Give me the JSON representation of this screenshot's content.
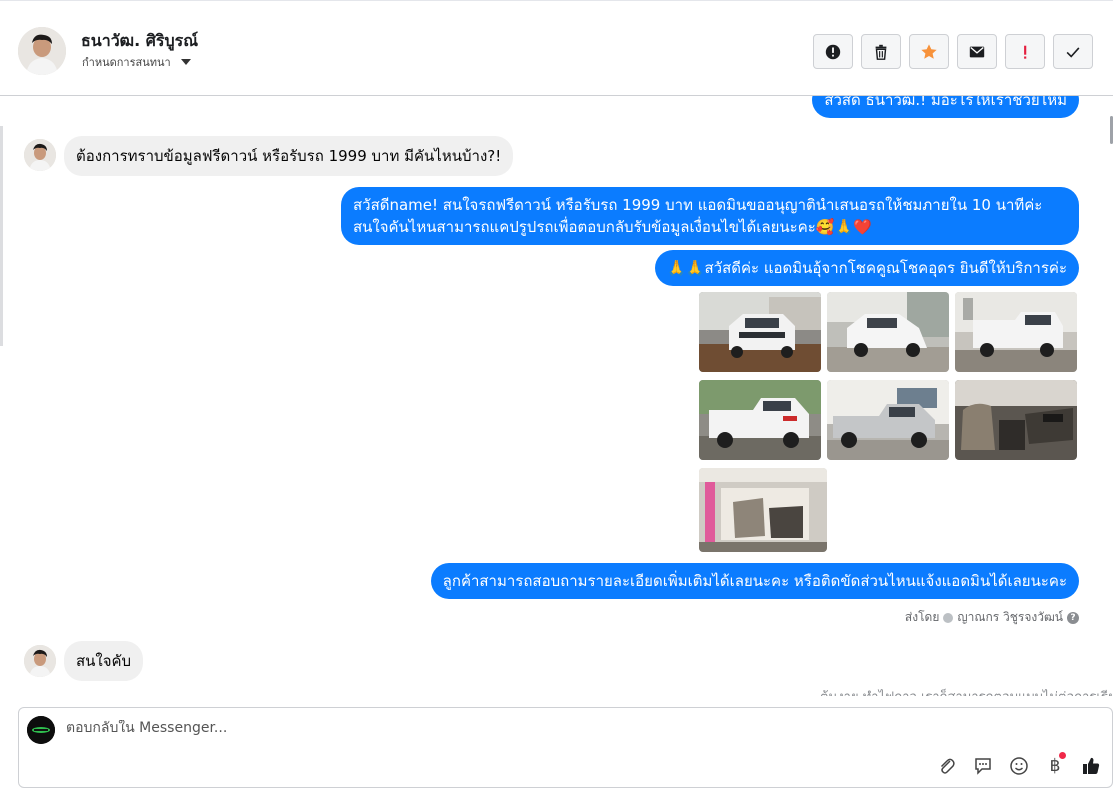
{
  "header": {
    "name": "ธนาวัฒ. ศิริบูรณ์",
    "subtitle": "กำหนดการสนทนา",
    "actions": [
      {
        "icon": "alert-circle-icon"
      },
      {
        "icon": "trash-icon"
      },
      {
        "icon": "star-icon",
        "color": "#f7923b"
      },
      {
        "icon": "mail-icon"
      },
      {
        "icon": "exclamation-icon",
        "color": "#e41e3f"
      },
      {
        "icon": "check-icon"
      }
    ]
  },
  "messages": {
    "top_partial": "สวัสดี ธนาวัฒ.! มีอะไรให้เราช่วยไหม",
    "customer_1": "ต้องการทราบข้อมูลฟรีดาวน์ หรือรับรถ 1999 บาท มีคันไหนบ้าง?!",
    "agent_1": "สวัสดีname! สนใจรถฟรีดาวน์ หรือรับรถ 1999 บาท แอดมินขออนุญาตินำเสนอรถให้ชมภายใน 10 นาทีค่ะ สนใจคันไหนสามารถแคปรูปรถเพื่อตอบกลับรับข้อมูลเงื่อนไขได้เลยนะคะ🥰🙏❤️",
    "agent_2": "🙏🙏สวัสดีค่ะ แอดมินอุ้จากโชคคูณโชคอุดร ยินดีให้บริการค่ะ",
    "agent_3": "ลูกค้าสามารถสอบถามรายละเอียดเพิ่มเติมได้เลยนะคะ หรือติดขัดส่วนไหนแจ้งแอดมินได้เลยนะคะ",
    "sent_by_prefix": "ส่งโดย",
    "sent_by_name": "ญาณกร วิชูรจงวัฒน์",
    "customer_2": "สนใจคับ",
    "bottom_partial": "ต้นงาย ทำไฟกาว เราก็สามารถตอบแบบไม่ต่อการเรียงกัน"
  },
  "photos": [
    {
      "name": "car-photo-1",
      "theme": "front"
    },
    {
      "name": "car-photo-2",
      "theme": "front-side"
    },
    {
      "name": "car-photo-3",
      "theme": "rear"
    },
    {
      "name": "car-photo-4",
      "theme": "rear-side"
    },
    {
      "name": "car-photo-5",
      "theme": "side"
    },
    {
      "name": "car-photo-6",
      "theme": "interior"
    },
    {
      "name": "car-photo-7",
      "theme": "cabin"
    }
  ],
  "composer": {
    "placeholder": "ตอบกลับใน Messenger...",
    "tools": [
      "paperclip-icon",
      "saved-reply-icon",
      "emoji-icon",
      "baht-icon",
      "thumbs-up-icon"
    ],
    "baht_symbol": "฿"
  },
  "colors": {
    "outgoing_bubble": "#0b7cff",
    "incoming_bubble": "#f0f0f0",
    "thumbs_up": "#1c1e21"
  }
}
